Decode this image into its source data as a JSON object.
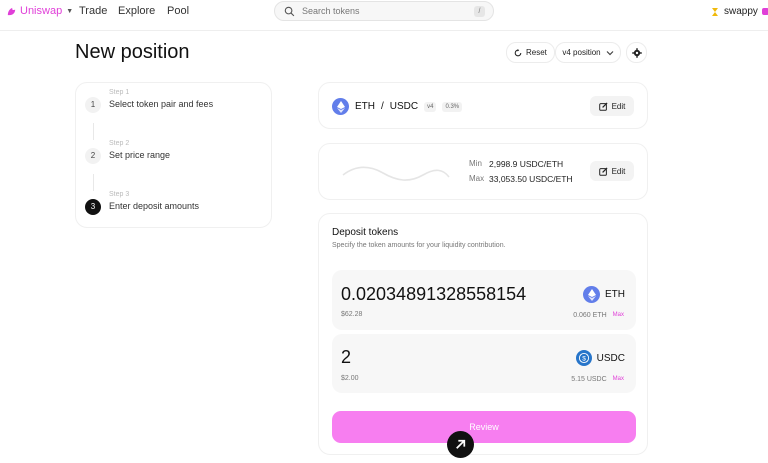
{
  "nav": {
    "brand": "Uniswap",
    "links": [
      "Trade",
      "Explore",
      "Pool"
    ],
    "search_placeholder": "Search tokens",
    "search_shortcut": "/",
    "account_name": "swappy"
  },
  "header": {
    "title": "New position",
    "reset_label": "Reset",
    "version_label": "v4 position"
  },
  "steps": [
    {
      "label": "Step 1",
      "title": "Select token pair and fees",
      "number": "1"
    },
    {
      "label": "Step 2",
      "title": "Set price range",
      "number": "2"
    },
    {
      "label": "Step 3",
      "title": "Enter deposit amounts",
      "number": "3"
    }
  ],
  "pair": {
    "token0": "ETH",
    "separator": "/",
    "token1": "USDC",
    "version_tag": "v4",
    "fee_tag": "0.3%",
    "edit_label": "Edit"
  },
  "range": {
    "min_label": "Min",
    "min_value": "2,998.9 USDC/ETH",
    "max_label": "Max",
    "max_value": "33,053.50 USDC/ETH",
    "edit_label": "Edit"
  },
  "deposit": {
    "title": "Deposit tokens",
    "subtitle": "Specify the token amounts for your liquidity contribution.",
    "eth": {
      "amount": "0.020348913285581 54",
      "usd": "$62.28",
      "symbol": "ETH",
      "balance": "0.060 ETH",
      "max_label": "Max"
    },
    "usdc": {
      "amount": "2",
      "usd": "$2.00",
      "symbol": "USDC",
      "balance": "5.15 USDC",
      "max_label": "Max"
    },
    "review_label": "Review"
  },
  "colors": {
    "brand": "#e03fd8",
    "review_button": "#f77ef0",
    "eth": "#627eea",
    "usdc": "#2775ca"
  }
}
